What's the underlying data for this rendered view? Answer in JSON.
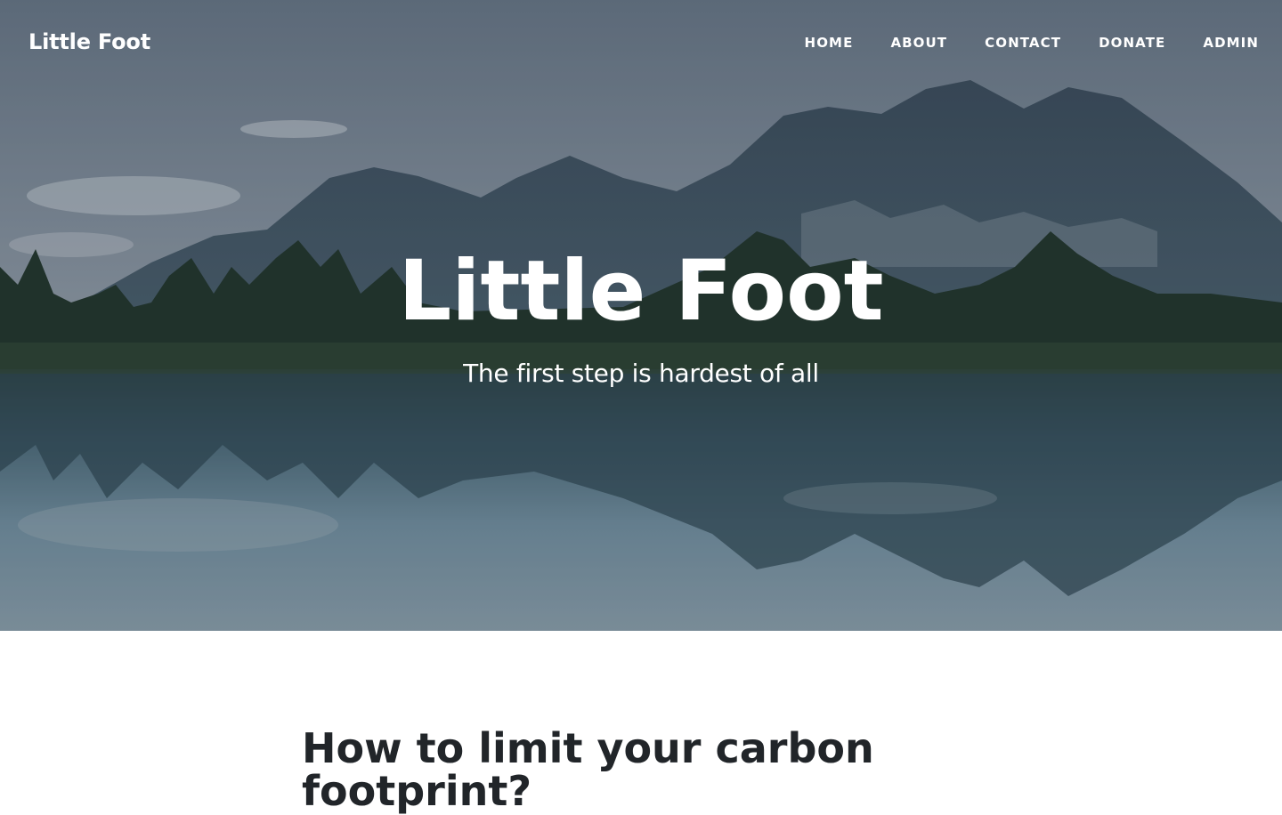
{
  "navbar": {
    "brand": "Little Foot",
    "links": [
      {
        "label": "HOME"
      },
      {
        "label": "ABOUT"
      },
      {
        "label": "CONTACT"
      },
      {
        "label": "DONATE"
      },
      {
        "label": "ADMIN"
      }
    ]
  },
  "hero": {
    "title": "Little Foot",
    "subtitle": "The first step is hardest of all",
    "image": "mountain-lake-reflection"
  },
  "post": {
    "title": "How to limit your carbon footprint?"
  },
  "colors": {
    "nav_text": "#ffffff",
    "post_title": "#212529",
    "background": "#ffffff"
  }
}
